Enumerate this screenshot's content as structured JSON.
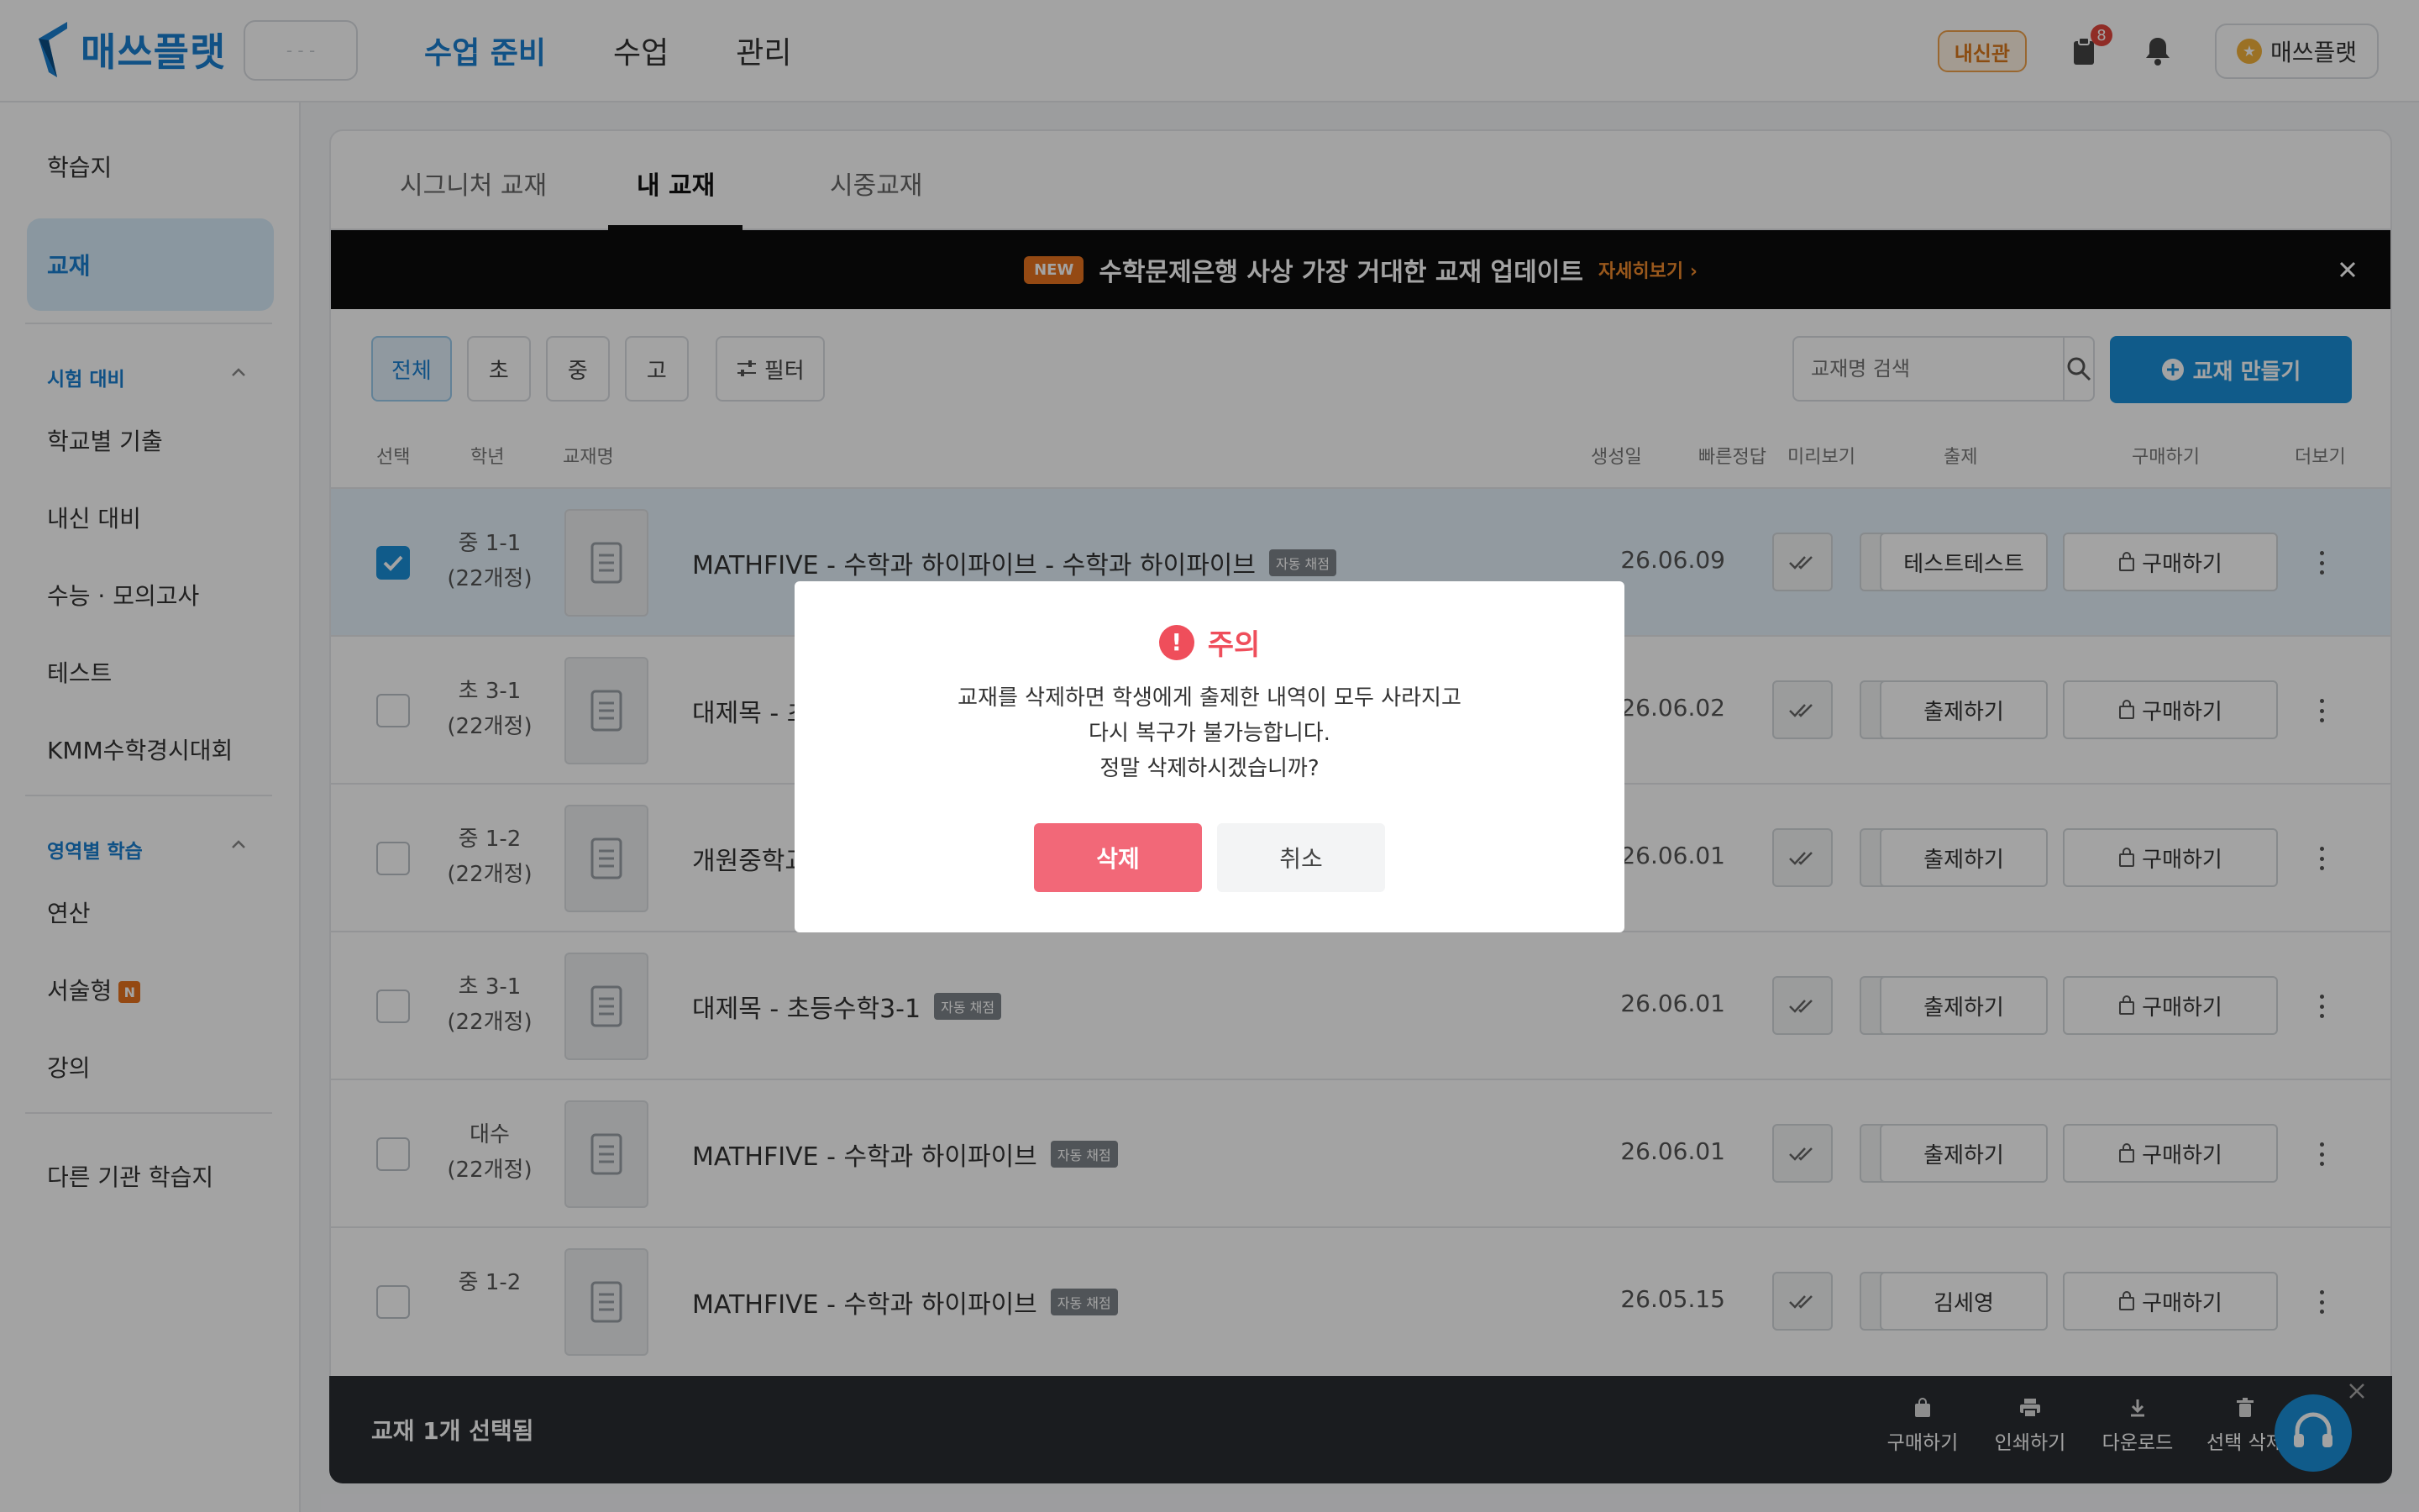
{
  "header": {
    "brand": "매쓰플랫",
    "org_placeholder": "- - -",
    "nav": [
      "수업 준비",
      "수업",
      "관리"
    ],
    "badge": "내신관",
    "notification_count": "8",
    "user_name": "매쓰플랫",
    "brand_color": "#1a7fd0"
  },
  "sidebar": {
    "top_items": [
      "학습지",
      "교재"
    ],
    "active_item": "교재",
    "section1_title": "시험 대비",
    "section1_items": [
      "학교별 기출",
      "내신 대비",
      "수능 · 모의고사",
      "테스트",
      "KMM수학경시대회"
    ],
    "section2_title": "영역별 학습",
    "section2_items": [
      "연산",
      "서술형",
      "강의"
    ],
    "new_badge": "N",
    "bottom_item": "다른 기관 학습지"
  },
  "tabs": [
    "시그니처 교재",
    "내 교재",
    "시중교재"
  ],
  "active_tab": "내 교재",
  "banner": {
    "tag": "NEW",
    "text": "수학문제은행 사상 가장 거대한 교재 업데이트",
    "link": "자세히보기"
  },
  "filters": [
    "전체",
    "초",
    "중",
    "고"
  ],
  "filter_button": "필터",
  "search": {
    "placeholder": "교재명 검색"
  },
  "create_button": "교재 만들기",
  "columns": [
    "선택",
    "학년",
    "교재명",
    "생성일",
    "빠른정답",
    "미리보기",
    "출제",
    "구매하기",
    "더보기"
  ],
  "auto_tag": "자동 채점",
  "buy_label": "구매하기",
  "rows": [
    {
      "grade1": "중 1-1",
      "grade2": "(22개정)",
      "title": "MATHFIVE - 수학과 하이파이브 - 수학과 하이파이브",
      "date": "26.06.09",
      "assign": "테스트테스트",
      "checked": true
    },
    {
      "grade1": "초 3-1",
      "grade2": "(22개정)",
      "title": "대제목 - 초",
      "date": "26.06.02",
      "assign": "출제하기",
      "checked": false
    },
    {
      "grade1": "중 1-2",
      "grade2": "(22개정)",
      "title": "개원중학교",
      "date": "26.06.01",
      "assign": "출제하기",
      "checked": false
    },
    {
      "grade1": "초 3-1",
      "grade2": "(22개정)",
      "title": "대제목 - 초등수학3-1",
      "date": "26.06.01",
      "assign": "출제하기",
      "checked": false
    },
    {
      "grade1": "대수",
      "grade2": "(22개정)",
      "title": "MATHFIVE - 수학과 하이파이브",
      "date": "26.06.01",
      "assign": "출제하기",
      "checked": false
    },
    {
      "grade1": "중 1-2",
      "grade2": "",
      "title": "MATHFIVE - 수학과 하이파이브",
      "date": "26.05.15",
      "assign": "김세영",
      "checked": false
    }
  ],
  "action_bar": {
    "selected_text": "교재 1개 선택됨",
    "actions": [
      "구매하기",
      "인쇄하기",
      "다운로드",
      "선택 삭제"
    ]
  },
  "modal": {
    "title": "주의",
    "line1": "교재를 삭제하면 학생에게 출제한 내역이 모두 사라지고",
    "line2": "다시 복구가 불가능합니다.",
    "line3": "정말 삭제하시겠습니까?",
    "confirm": "삭제",
    "cancel": "취소",
    "danger_color": "#ef4e5b"
  }
}
